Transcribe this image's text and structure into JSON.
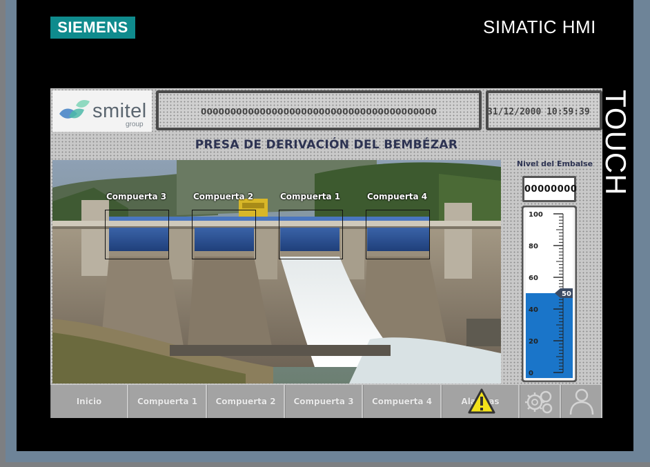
{
  "device": {
    "brand": "SIEMENS",
    "product": "SIMATIC HMI",
    "model_side_label": "TOUCH",
    "brand_color": "#0f8b8d"
  },
  "header": {
    "logo": {
      "word": "smitel",
      "sub": "group"
    },
    "message": "0000000000000000000000000000000000000000",
    "datetime": "31/12/2000 10:59:39"
  },
  "page": {
    "title": "PRESA DE DERIVACIÓN DEL BEMBÉZAR"
  },
  "gates": [
    {
      "label": "Compuerta 3"
    },
    {
      "label": "Compuerta 2"
    },
    {
      "label": "Compuerta 1"
    },
    {
      "label": "Compuerta 4"
    }
  ],
  "level": {
    "title": "Nivel del Embalse",
    "display_value": "00000000",
    "scale_min": 0,
    "scale_max": 100,
    "ticks": [
      "0",
      "20",
      "40",
      "60",
      "80",
      "100"
    ],
    "current": 50,
    "current_label": "50",
    "fill_color": "#1a75c9"
  },
  "nav": {
    "items": [
      {
        "label": "Inicio"
      },
      {
        "label": "Compuerta 1"
      },
      {
        "label": "Compuerta 2"
      },
      {
        "label": "Compuerta 3"
      },
      {
        "label": "Compuerta 4"
      },
      {
        "label": "Alarmas"
      }
    ],
    "icons": [
      "alarm-warning-icon",
      "settings-gears-icon",
      "user-icon"
    ],
    "warning_color": "#f2e11a"
  }
}
